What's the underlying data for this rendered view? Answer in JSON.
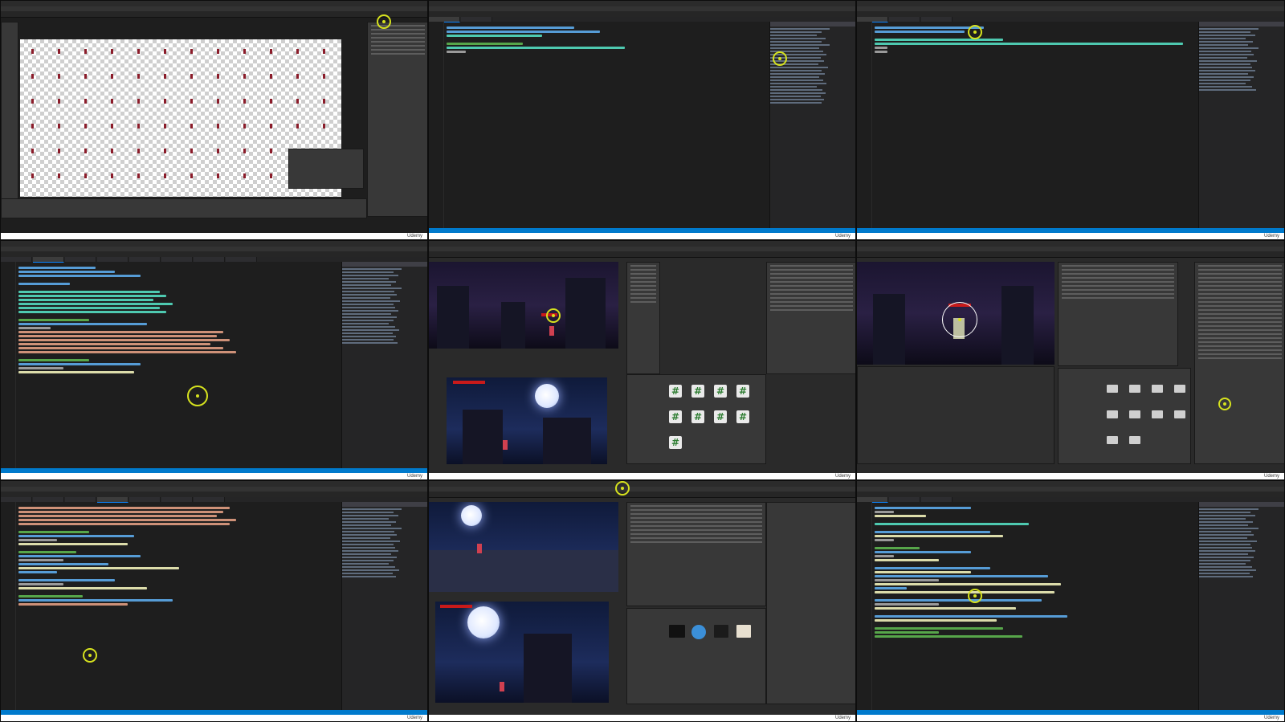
{
  "watermark": "Udemy",
  "tiles": [
    {
      "id": "sprite-editor",
      "label": "Sprite Editor"
    },
    {
      "id": "vs-code-editor-1"
    },
    {
      "id": "vs-code-editor-2"
    },
    {
      "id": "vs-code-enemy-states"
    },
    {
      "id": "unity-scene-game-1"
    },
    {
      "id": "unity-scene-inspector"
    },
    {
      "id": "vs-code-enemy-states-2"
    },
    {
      "id": "unity-scene-game-2"
    },
    {
      "id": "vs-code-update-method"
    }
  ],
  "colors": {
    "highlight": "#d6e21e",
    "editor_bg": "#1e1e1e",
    "status": "#007acc",
    "keyword": "#569cd6",
    "type": "#4ec9b0",
    "string": "#ce9178",
    "comment": "#57a64a"
  },
  "icons": [
    "cursor-highlight-icon",
    "script-asset-icon",
    "folder-icon",
    "moon-icon"
  ]
}
